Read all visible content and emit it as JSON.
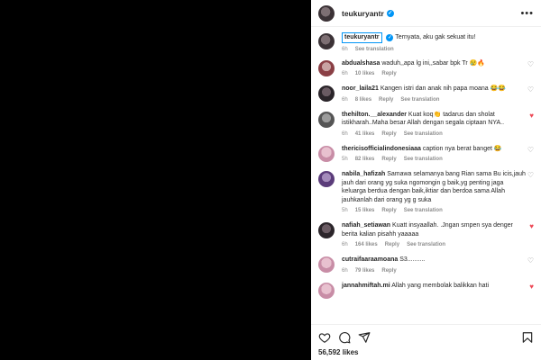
{
  "post": {
    "username": "teukuryantr",
    "more_icon": "more-horizontal-icon"
  },
  "caption": {
    "username": "teukuryantr",
    "text": "Ternyata, aku gak sekuat itu!",
    "time": "6h",
    "see_translation": "See translation"
  },
  "comments": [
    {
      "username": "abdualshasa",
      "text": "waduh,,apa lg ini,,sabar bpk Tr 😢🔥",
      "time": "6h",
      "likes": "10 likes",
      "reply": "Reply",
      "translate": "",
      "liked": false
    },
    {
      "username": "noor_laila21",
      "text": "Kangen istri dan anak nih papa moana 😂😂",
      "time": "6h",
      "likes": "8 likes",
      "reply": "Reply",
      "translate": "See translation",
      "liked": false
    },
    {
      "username": "thehilton.__alexander",
      "text": "Kuat koq👏 tadarus dan sholat istikharah..Maha besar Allah dengan segala ciptaan NYA..",
      "time": "6h",
      "likes": "41 likes",
      "reply": "Reply",
      "translate": "See translation",
      "liked": true
    },
    {
      "username": "thericisofficialindonesiaaa",
      "text": "caption nya berat banget 😂",
      "time": "5h",
      "likes": "82 likes",
      "reply": "Reply",
      "translate": "See translation",
      "liked": false
    },
    {
      "username": "nabila_hafizah",
      "text": "Samawa selamanya bang Rian sama Bu icis,jauh jauh dari orang yg suka ngomongin g baik,yg penting jaga keluarga berdua dengan baik,iktiar dan berdoa sama Allah jauhkanlah dari orang yg g suka",
      "time": "5h",
      "likes": "15 likes",
      "reply": "Reply",
      "translate": "See translation",
      "liked": false
    },
    {
      "username": "nafiah_setiawan",
      "text": "Kuatt insyaallah. .Jngan smpen sya denger berita kalian pisahh yaaaaa",
      "time": "6h",
      "likes": "164 likes",
      "reply": "Reply",
      "translate": "See translation",
      "liked": true
    },
    {
      "username": "cutraifaaraamoana",
      "text": "S3..........",
      "time": "6h",
      "likes": "79 likes",
      "reply": "Reply",
      "translate": "",
      "liked": false
    },
    {
      "username": "jannahmiftah.mi",
      "text": "Allah yang membolak balikkan hati",
      "time": "",
      "likes": "",
      "reply": "",
      "translate": "",
      "liked": true
    }
  ],
  "footer": {
    "likes": "56,592 likes",
    "icons": [
      "heart-icon",
      "comment-icon",
      "share-icon",
      "bookmark-icon"
    ]
  }
}
